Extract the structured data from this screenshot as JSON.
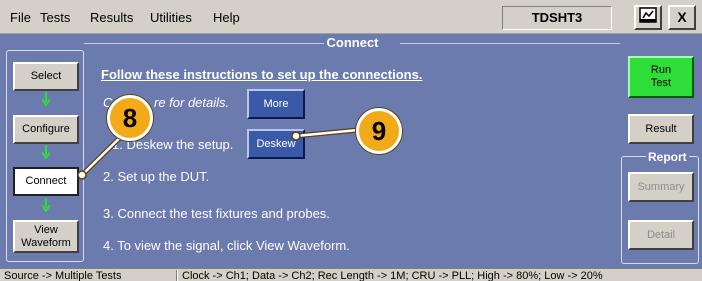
{
  "menu": {
    "items": [
      "File",
      "Tests",
      "Results",
      "Utilities",
      "Help"
    ],
    "app_title": "TDSHT3",
    "close_label": "X"
  },
  "panel": {
    "title": "Connect"
  },
  "steps": [
    {
      "label": "Select"
    },
    {
      "label": "Configure"
    },
    {
      "label": "Connect",
      "active": true
    },
    {
      "label": "View\nWaveform"
    }
  ],
  "instructions": {
    "heading": "Follow these instructions to set up the connections.",
    "details_prefix": "C",
    "details_suffix": "re for details.",
    "more_label": "More",
    "step1": "1. Deskew the setup.",
    "deskew_label": "Deskew",
    "step2": "2. Set up the DUT.",
    "step3": "3. Connect the test fixtures and probes.",
    "step4": "4. To view the signal, click View Waveform."
  },
  "right": {
    "run_label": "Run\nTest",
    "result_label": "Result",
    "report_label": "Report",
    "summary_label": "Summary",
    "detail_label": "Detail"
  },
  "callouts": [
    "8",
    "9"
  ],
  "status": {
    "left": "Source -> Multiple Tests",
    "right": "Clock -> Ch1; Data -> Ch2; Rec Length -> 1M; CRU -> PLL; High -> 80%; Low -> 20%"
  },
  "colors": {
    "panel_bg": "#6b7bae",
    "run_green": "#2edc3a",
    "callout_orange": "#f2aa18",
    "blue_button": "#3a5aa8"
  }
}
